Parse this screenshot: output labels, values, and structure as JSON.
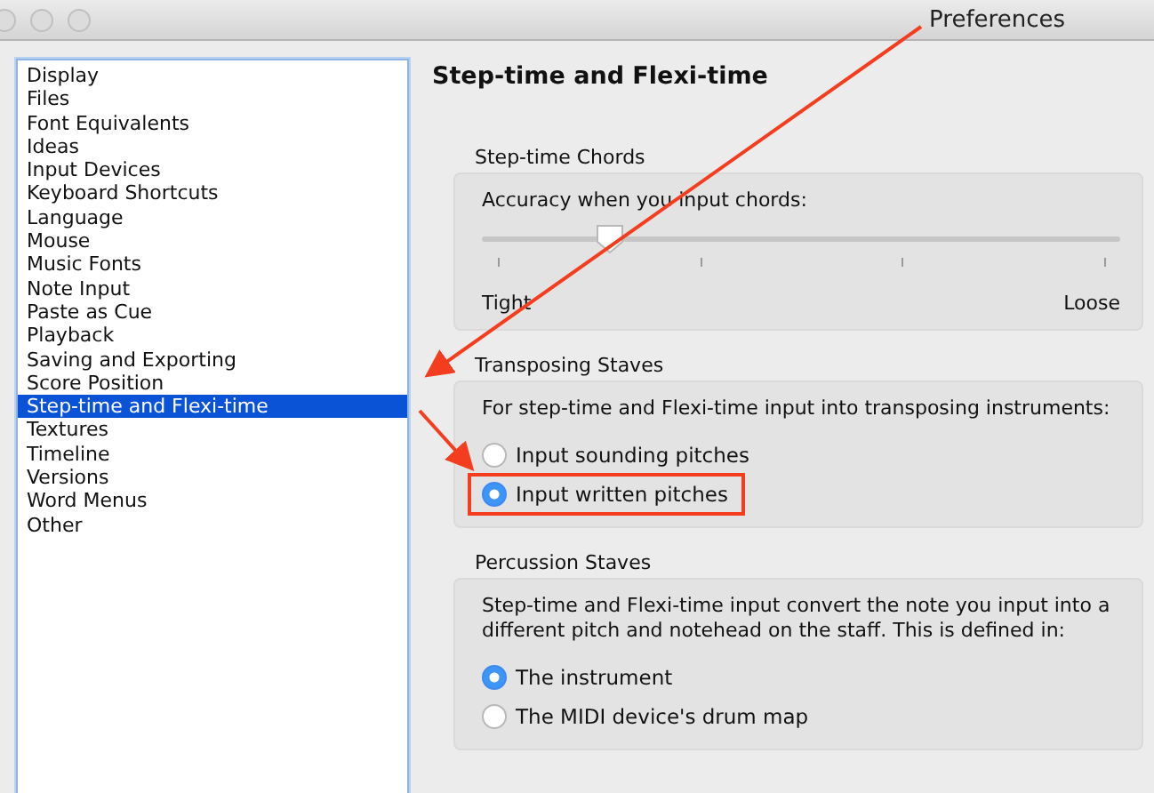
{
  "window": {
    "title": "Preferences"
  },
  "sidebar": {
    "items": [
      {
        "label": "Display",
        "selected": false
      },
      {
        "label": "Files",
        "selected": false
      },
      {
        "label": "Font Equivalents",
        "selected": false
      },
      {
        "label": "Ideas",
        "selected": false
      },
      {
        "label": "Input Devices",
        "selected": false
      },
      {
        "label": "Keyboard Shortcuts",
        "selected": false
      },
      {
        "label": "Language",
        "selected": false
      },
      {
        "label": "Mouse",
        "selected": false
      },
      {
        "label": "Music Fonts",
        "selected": false
      },
      {
        "label": "Note Input",
        "selected": false
      },
      {
        "label": "Paste as Cue",
        "selected": false
      },
      {
        "label": "Playback",
        "selected": false
      },
      {
        "label": "Saving and Exporting",
        "selected": false
      },
      {
        "label": "Score Position",
        "selected": false
      },
      {
        "label": "Step-time and Flexi-time",
        "selected": true
      },
      {
        "label": "Textures",
        "selected": false
      },
      {
        "label": "Timeline",
        "selected": false
      },
      {
        "label": "Versions",
        "selected": false
      },
      {
        "label": "Word Menus",
        "selected": false
      },
      {
        "label": "Other",
        "selected": false
      }
    ]
  },
  "page": {
    "heading": "Step-time and Flexi-time",
    "groups": [
      {
        "kind": "slider",
        "title": "Step-time Chords",
        "prompt": "Accuracy when you input chords:",
        "level": 0.2,
        "min_label": "Tight",
        "max_label": "Loose"
      },
      {
        "kind": "radios",
        "title": "Transposing Staves",
        "prompt": "For step-time and Flexi-time input into transposing instruments:",
        "options": [
          {
            "label": "Input sounding pitches",
            "selected": false,
            "highlighted": false
          },
          {
            "label": "Input written pitches",
            "selected": true,
            "highlighted": true
          }
        ]
      },
      {
        "kind": "radios",
        "title": "Percussion Staves",
        "prompt": "Step-time and Flexi-time input convert the note you input into a different pitch and notehead on the staff. This is defined in:",
        "options": [
          {
            "label": "The instrument",
            "selected": true,
            "highlighted": false
          },
          {
            "label": "The MIDI device's drum map",
            "selected": false,
            "highlighted": false
          }
        ]
      }
    ]
  }
}
